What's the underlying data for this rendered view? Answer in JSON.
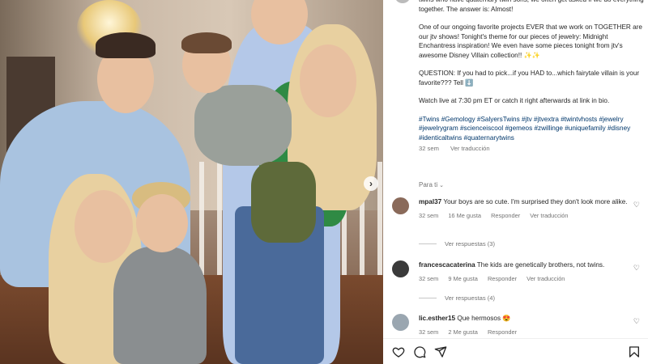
{
  "caption": {
    "paragraphs": [
      "twins who have quaternary twin sons, we often get asked if we do everything together. The answer is: Almost!",
      "One of our ongoing favorite projects EVER that we work on TOGETHER are our jtv shows! Tonight's theme for our pieces of jewelry: Midnight Enchantress inspiration! We even have some pieces tonight from jtv's awesome Disney Villain collection!! ✨✨",
      "QUESTION: If you had to pick...if you HAD to...which fairytale villain is your favorite??? Tell ⬇️",
      "Watch live at 7:30 pm ET or catch it right afterwards at link in bio."
    ],
    "hashtags": "#Twins #Gemology #SalyersTwins #jtv #jtvextra #twintvhosts #jewelry #jewelrygram #scienceiscool #gemeos #zwillinge #uniquefamily #disney #identicaltwins #quaternarytwins",
    "age": "32 sem",
    "translate": "Ver traducción"
  },
  "sort_label": "Para ti",
  "comments": [
    {
      "user": "mpal37",
      "text": "Your boys are so cute. I'm surprised they don't look more alike.",
      "age": "32 sem",
      "likes": "16 Me gusta",
      "reply": "Responder",
      "translate": "Ver traducción",
      "replies": "Ver respuestas (3)",
      "avatar_color": "#8a6a5a"
    },
    {
      "user": "francescacaterina",
      "text": "The kids are genetically brothers, not twins.",
      "age": "32 sem",
      "likes": "9 Me gusta",
      "reply": "Responder",
      "translate": "Ver traducción",
      "replies": "Ver respuestas (4)",
      "avatar_color": "#3a3a3a"
    },
    {
      "user": "lic.esther15",
      "text": "Que hermosos 😍",
      "age": "32 sem",
      "likes": "2 Me gusta",
      "reply": "Responder",
      "translate": "",
      "replies": "",
      "avatar_color": "#9aa6b0"
    }
  ],
  "icons": {
    "carousel_next": "chevron-right-icon",
    "like": "heart-icon",
    "comment": "comment-icon",
    "share": "send-icon",
    "save": "bookmark-icon",
    "comment_like": "heart-outline-icon"
  },
  "colors": {
    "link_blue": "#00376b",
    "muted": "#737373",
    "text": "#262626"
  }
}
